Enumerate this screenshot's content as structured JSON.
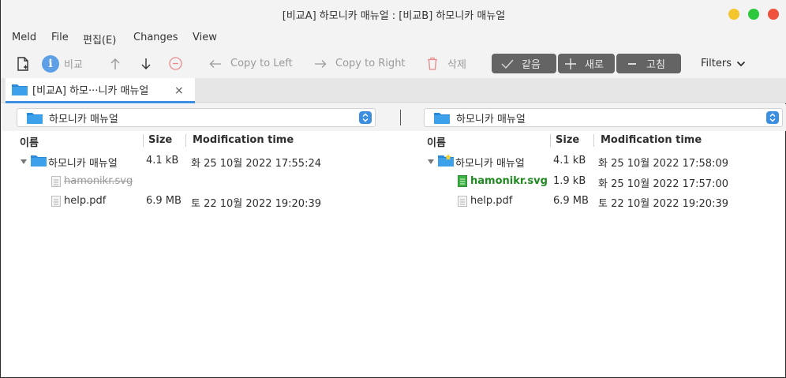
{
  "window": {
    "title": "[비교A] 하모니카 매뉴얼 : [비교B] 하모니카 매뉴얼"
  },
  "menu": [
    "Meld",
    "File",
    "편집(E)",
    "Changes",
    "View"
  ],
  "toolbar": {
    "compare_label": "비교",
    "copy_left_label": "Copy to Left",
    "copy_right_label": "Copy to Right",
    "delete_label": "삭제",
    "same_label": "같음",
    "new_label": "새로",
    "modified_label": "고침",
    "filters_label": "Filters"
  },
  "tab": {
    "label": "[비교A] 하모···니카 매뉴얼"
  },
  "location": {
    "left": "하모니카 매뉴얼",
    "right": "하모니카 매뉴얼"
  },
  "columns": {
    "name": "이름",
    "size": "Size",
    "mtime": "Modification time"
  },
  "left_pane": {
    "rows": [
      {
        "name": "하모니카 매뉴얼",
        "size": "4.1 kB",
        "mtime": "화 25 10월 2022 17:55:24"
      },
      {
        "name": "hamonikr.svg",
        "size": "",
        "mtime": ""
      },
      {
        "name": "help.pdf",
        "size": "6.9 MB",
        "mtime": "토 22 10월 2022 19:20:39"
      }
    ]
  },
  "right_pane": {
    "rows": [
      {
        "name": "하모니카 매뉴얼",
        "size": "4.1 kB",
        "mtime": "화 25 10월 2022 17:58:09"
      },
      {
        "name": "hamonikr.svg",
        "size": "1.9 kB",
        "mtime": "화 25 10월 2022 17:57:00"
      },
      {
        "name": "help.pdf",
        "size": "6.9 MB",
        "mtime": "토 22 10월 2022 19:20:39"
      }
    ]
  },
  "colors": {
    "accent": "#3c8fe0",
    "new_file": "#1f8a1f",
    "missing_file": "#9a9a9a",
    "filter_segment": "#646464"
  }
}
